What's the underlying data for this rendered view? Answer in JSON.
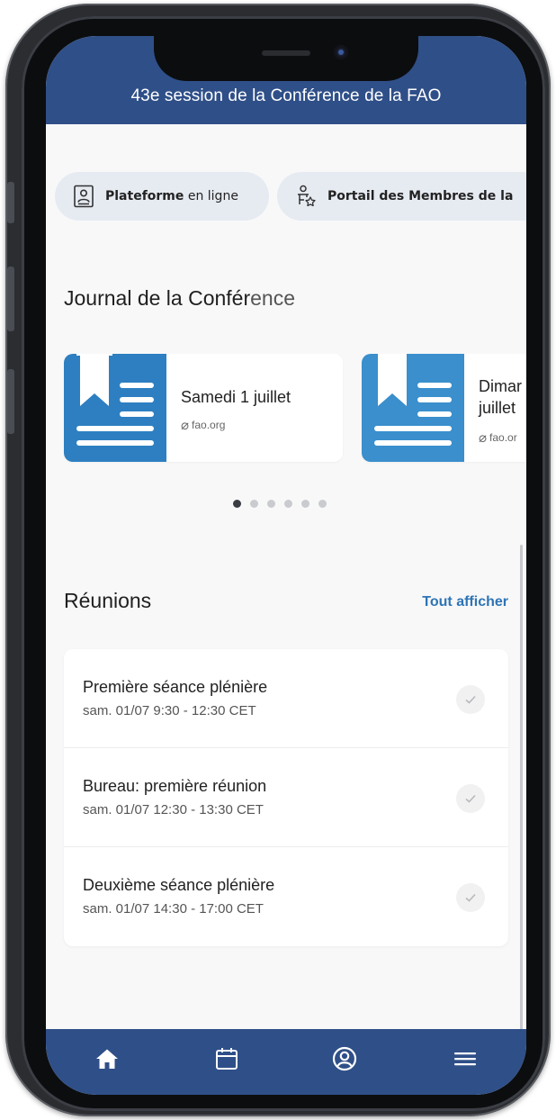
{
  "header": {
    "title": "43e session de la Conférence de la FAO"
  },
  "quick_links": [
    {
      "label_bold": "Plateforme",
      "label_rest": " en ligne",
      "icon": "id-card-icon"
    },
    {
      "label_bold": "Portail des Membres de la",
      "label_rest": "",
      "icon": "presenter-star-icon"
    }
  ],
  "journal": {
    "title_a": "Journal de la Confér",
    "title_b": "ence",
    "cards": [
      {
        "title": "Samedi 1 juillet",
        "link": "fao.org"
      },
      {
        "title_line1": "Dimar",
        "title_line2": "juillet",
        "link": "fao.or"
      }
    ],
    "dots": {
      "count": 6,
      "active": 0
    }
  },
  "meetings": {
    "title": "Réunions",
    "see_all": "Tout afficher",
    "items": [
      {
        "name": "Première séance plénière",
        "time": "sam. 01/07 9:30 - 12:30 CET"
      },
      {
        "name": "Bureau: première réunion",
        "time": "sam. 01/07 12:30 - 13:30 CET"
      },
      {
        "name": "Deuxième séance plénière",
        "time": "sam. 01/07 14:30 - 17:00 CET"
      }
    ]
  },
  "nav": [
    "home-icon",
    "calendar-icon",
    "profile-icon",
    "menu-icon"
  ],
  "colors": {
    "brand": "#2f4f88",
    "link": "#2e74b5",
    "journal_icon": "#2d7fc1"
  }
}
